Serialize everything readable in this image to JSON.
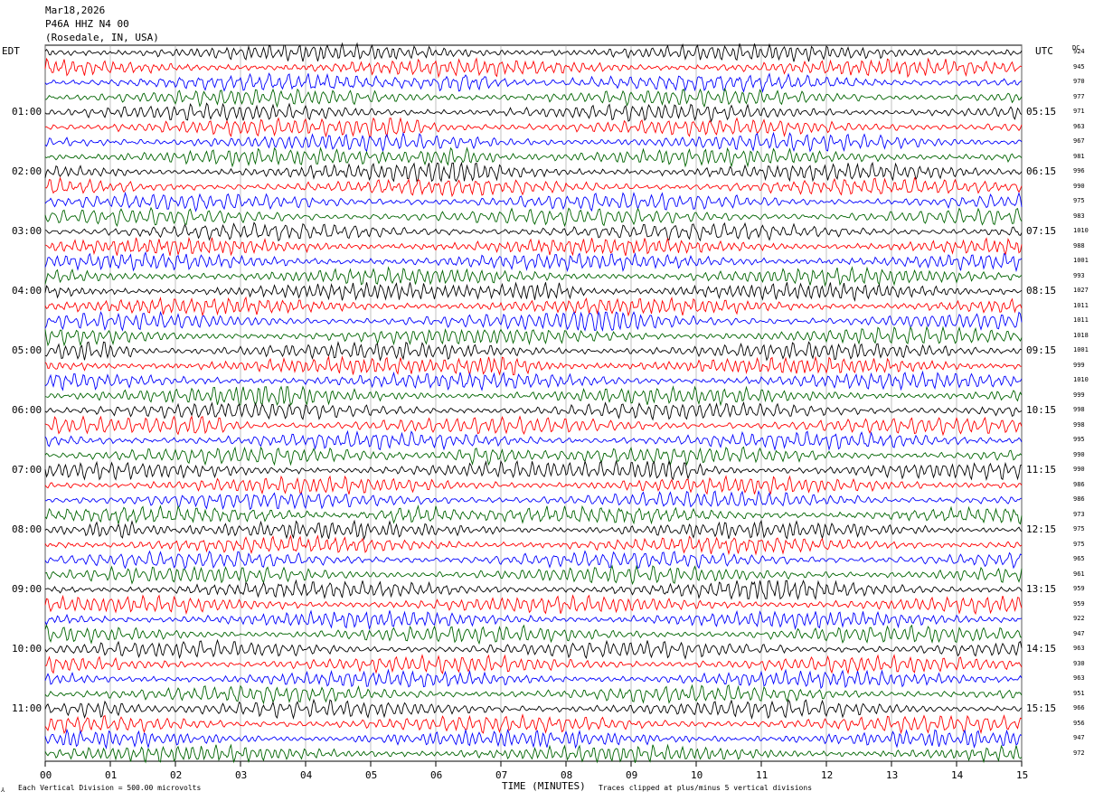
{
  "header": {
    "date": "Mar18,2026",
    "station": "P46A HHZ N4 00",
    "location": "(Rosedale, IN, USA)"
  },
  "chart_data": {
    "type": "line",
    "title": "Mar18,2026 P46A HHZ N4 00 (Rosedale, IN, USA)",
    "xlabel": "TIME (MINUTES)",
    "xticks": [
      "00",
      "01",
      "02",
      "03",
      "04",
      "05",
      "06",
      "07",
      "08",
      "09",
      "10",
      "11",
      "12",
      "13",
      "14",
      "15"
    ],
    "xlim": [
      0,
      15
    ],
    "left_timezone": "EDT",
    "right_timezone": "UTC",
    "dc_label": "DC",
    "left_hours": [
      "01:00",
      "02:00",
      "03:00",
      "04:00",
      "05:00",
      "06:00",
      "07:00",
      "08:00",
      "09:00",
      "10:00",
      "11:00"
    ],
    "right_hours": [
      "05:15",
      "06:15",
      "07:15",
      "08:15",
      "09:15",
      "10:15",
      "11:15",
      "12:15",
      "13:15",
      "14:15",
      "15:15"
    ],
    "trace_colors": [
      "#000000",
      "#ff0000",
      "#0000ff",
      "#006400"
    ],
    "dc_offsets": [
      924,
      945,
      970,
      977,
      971,
      963,
      967,
      981,
      996,
      990,
      975,
      983,
      1010,
      988,
      1001,
      993,
      1027,
      1011,
      1011,
      1018,
      1001,
      999,
      1010,
      999,
      998,
      998,
      995,
      990,
      990,
      986,
      986,
      973,
      975,
      975,
      965,
      961,
      959,
      959,
      922,
      947,
      963,
      930,
      963,
      951,
      966,
      956,
      947,
      972
    ],
    "footer_left": "Each Vertical Division = 500.00 microvolts",
    "footer_right": "Traces clipped at plus/minus 5 vertical divisions"
  }
}
